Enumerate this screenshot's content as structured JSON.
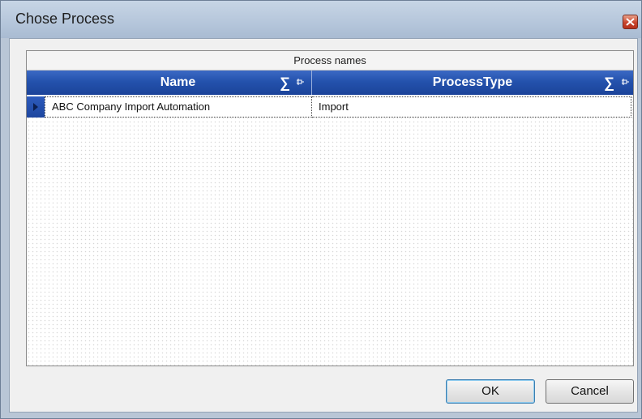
{
  "window": {
    "title": "Chose Process"
  },
  "grid": {
    "group_title": "Process names",
    "columns": [
      {
        "label": "Name"
      },
      {
        "label": "ProcessType"
      }
    ],
    "rows": [
      {
        "name": "ABC Company Import Automation",
        "process_type": "Import"
      }
    ]
  },
  "buttons": {
    "ok_label": "OK",
    "cancel_label": "Cancel"
  },
  "colors": {
    "header_blue": "#2452ad",
    "title_bar": "#b5c6db",
    "close_red": "#c9452d"
  }
}
